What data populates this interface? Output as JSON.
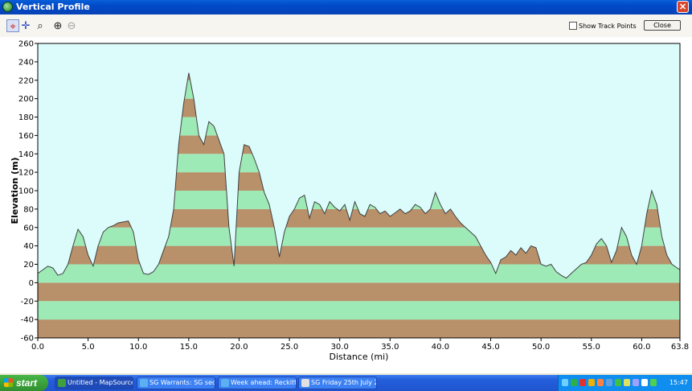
{
  "window": {
    "title": "Vertical Profile",
    "close_glyph": "✕",
    "icon": "mapsource-icon"
  },
  "toolbar": {
    "tools": [
      {
        "name": "crosshair-tool",
        "glyph": "⌖",
        "color": "#D02020"
      },
      {
        "name": "move-tool",
        "glyph": "✛",
        "color": "#2040C0"
      },
      {
        "name": "select-tool",
        "glyph": "⌕",
        "color": "#202020"
      },
      {
        "name": "zoom-in-tool",
        "glyph": "⊕",
        "color": "#202020"
      },
      {
        "name": "zoom-out-tool",
        "glyph": "⊖",
        "color": "#A0A0A0"
      }
    ],
    "show_track_points_label": "Show Track Points",
    "show_track_points_checked": false,
    "close_label": "Close"
  },
  "chart_data": {
    "type": "area",
    "xlabel": "Distance  (mi)",
    "ylabel": "Elevation (m)",
    "xlim": [
      0,
      63.8
    ],
    "ylim": [
      -60,
      260
    ],
    "xticks": [
      "0.0",
      "5.0",
      "10.0",
      "15.0",
      "20.0",
      "25.0",
      "30.0",
      "35.0",
      "40.0",
      "45.0",
      "50.0",
      "55.0",
      "60.0",
      "63.8"
    ],
    "yticks": [
      "260",
      "240",
      "220",
      "200",
      "180",
      "160",
      "140",
      "120",
      "100",
      "80",
      "60",
      "40",
      "20",
      "0",
      "-20",
      "-40",
      "-60"
    ],
    "band_colors": {
      "light": "#9EEAB6",
      "dark": "#B8906A"
    },
    "sky_color": "#DCFCFC",
    "x": [
      0,
      0.5,
      1,
      1.5,
      2,
      2.5,
      3,
      3.5,
      4,
      4.5,
      5,
      5.5,
      6,
      6.5,
      7,
      7.5,
      8,
      8.5,
      9,
      9.5,
      10,
      10.5,
      11,
      11.5,
      12,
      12.5,
      13,
      13.5,
      14,
      14.5,
      15,
      15.5,
      16,
      16.5,
      17,
      17.5,
      18,
      18.5,
      19,
      19.5,
      20,
      20.5,
      21,
      21.5,
      22,
      22.5,
      23,
      23.5,
      24,
      24.5,
      25,
      25.5,
      26,
      26.5,
      27,
      27.5,
      28,
      28.5,
      29,
      29.5,
      30,
      30.5,
      31,
      31.5,
      32,
      32.5,
      33,
      33.5,
      34,
      34.5,
      35,
      35.5,
      36,
      36.5,
      37,
      37.5,
      38,
      38.5,
      39,
      39.5,
      40,
      40.5,
      41,
      41.5,
      42,
      42.5,
      43,
      43.5,
      44,
      44.5,
      45,
      45.5,
      46,
      46.5,
      47,
      47.5,
      48,
      48.5,
      49,
      49.5,
      50,
      50.5,
      51,
      51.5,
      52,
      52.5,
      53,
      53.5,
      54,
      54.5,
      55,
      55.5,
      56,
      56.5,
      57,
      57.5,
      58,
      58.5,
      59,
      59.5,
      60,
      60.5,
      61,
      61.5,
      62,
      62.5,
      63,
      63.8
    ],
    "elevation": [
      10,
      14,
      18,
      16,
      8,
      10,
      20,
      40,
      58,
      50,
      30,
      18,
      40,
      55,
      60,
      62,
      65,
      66,
      67,
      55,
      25,
      10,
      9,
      12,
      20,
      35,
      50,
      80,
      150,
      195,
      228,
      200,
      160,
      150,
      175,
      170,
      155,
      140,
      60,
      18,
      120,
      150,
      148,
      135,
      120,
      98,
      85,
      60,
      28,
      55,
      72,
      80,
      92,
      95,
      70,
      88,
      85,
      75,
      88,
      82,
      78,
      85,
      68,
      88,
      75,
      72,
      85,
      82,
      75,
      78,
      72,
      76,
      80,
      75,
      78,
      85,
      82,
      75,
      80,
      98,
      85,
      75,
      80,
      72,
      65,
      60,
      55,
      50,
      40,
      30,
      22,
      10,
      25,
      28,
      35,
      30,
      38,
      32,
      40,
      38,
      20,
      18,
      20,
      12,
      8,
      5,
      10,
      15,
      20,
      22,
      30,
      42,
      48,
      40,
      22,
      35,
      60,
      50,
      30,
      20,
      40,
      75,
      100,
      85,
      50,
      30,
      20,
      14
    ]
  },
  "taskbar": {
    "start_label": "start",
    "items": [
      {
        "label": "Untitled - MapSource",
        "icon_color": "#3FA03F"
      },
      {
        "label": "SG Warrants: SG sec...",
        "icon_color": "#5AB0F0"
      },
      {
        "label": "Week ahead: Reckitt ...",
        "icon_color": "#5AB0F0"
      },
      {
        "label": "SG Friday 25th July 2...",
        "icon_color": "#E0E0E0"
      }
    ],
    "tray_colors": [
      "#6FD0FF",
      "#2DB04A",
      "#E03030",
      "#F0B000",
      "#FF8040",
      "#60A0E0",
      "#40C040",
      "#E0E060",
      "#A0A0FF",
      "#FFFFFF",
      "#50D050"
    ],
    "clock": "15:47"
  }
}
